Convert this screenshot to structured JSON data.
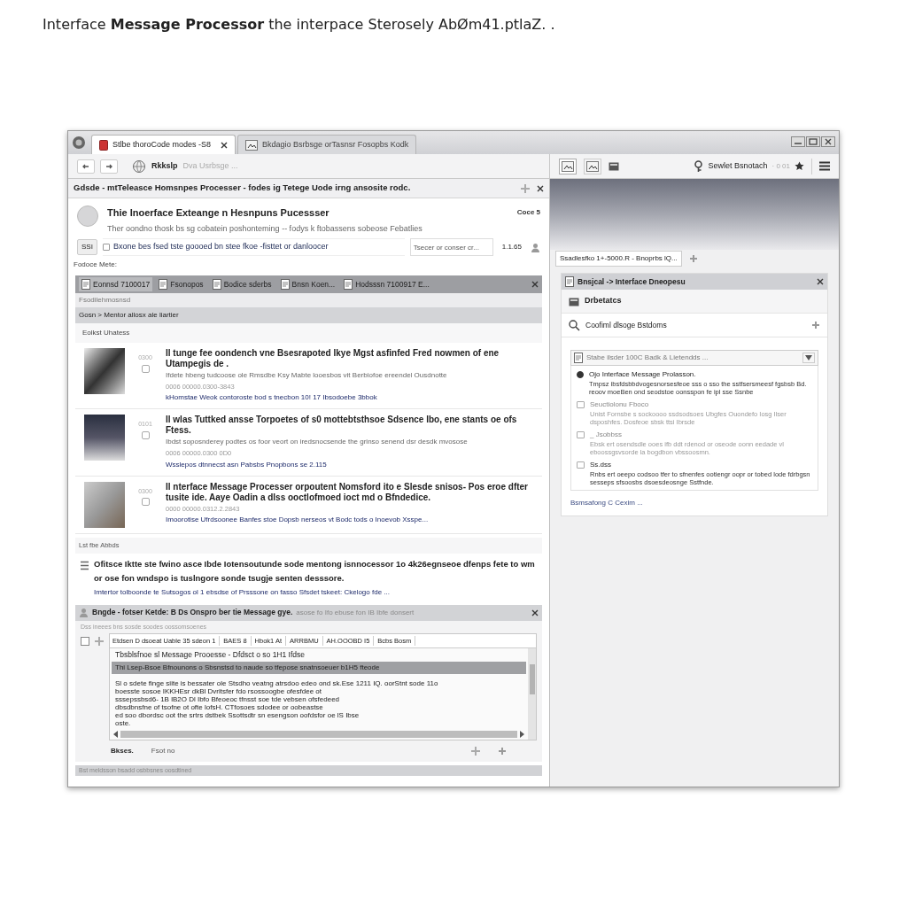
{
  "caption": "Interface **Message Processor** the interpace Sterosely AbØm41.ptlaZ. .",
  "tabs": [
    {
      "label": "Stlbe thoroCode modes -S8",
      "selected": true
    },
    {
      "label": "Bkdagio Bsrbsge orTasnsr Fosopbs Kodk",
      "selected": false
    }
  ],
  "address": {
    "site": "Rkkslp",
    "placeholder": "Dva Usrbsge ..."
  },
  "search": {
    "value": "Sewlet Bsnotach",
    "hint": "· 0 01"
  },
  "notification": "Gdsde - mtTeleasce Homsnpes Processer - fodes ig Tetege Uode irng ansosite rodc.",
  "post": {
    "title": "Thie Inoerface Exteange n Hesnpuns Pucessser",
    "count": "Coce 5",
    "subtitle": "Ther oondno thosk bs sg cobatein poshonteming -- fodys k ftobassens sobeose Febatlies",
    "button": "SSI",
    "option": {
      "label": "Bxone bes fsed tste goooed bn stee fkoe -fisttet or danloocer",
      "checked": false
    },
    "filter_placeholder": "Tsecer or conser cr...",
    "stat": "1.1.65"
  },
  "note_label": "Fodoce Mete:",
  "panel_tabs": [
    {
      "label": "Eonnsd 7100017",
      "selected": true
    },
    {
      "label": "Fsonopos",
      "selected": false
    },
    {
      "label": "Bodice sderbs",
      "selected": false
    },
    {
      "label": "Bnsn Koen...",
      "selected": false
    },
    {
      "label": "Hodsssn 7100917 E...",
      "selected": false
    }
  ],
  "subheading": "Fsodilehmosnsd",
  "breadcrumb": "Gosn > Mentor allosx ale liartier",
  "list_label": "Eolkst Uhatess",
  "results": [
    {
      "stat": "0300",
      "title": "Il tunge fee oondench vne Bsesrapoted Ikye Mgst asfinfed Fred nowmen of ene Utampegis de .",
      "desc": "Ifdete hbeng tudcoose ole Rmsdbe Ksy Mabte looesbos vit Berbiofoe ereendel Ousdnotte",
      "date": "0006 00000.0300-3843",
      "link": "kHomstae Weok contoroste bod s tnecbon 10! 17 Ibsodoebe 3bbok"
    },
    {
      "stat": "0101",
      "title": "Il wlas Tuttked ansse Torpoetes of s0 mottebtsthsoe Sdsence Ibo, ene stants oe ofs Ftess.",
      "desc": "Ibdst soposnderey podtes os foor veort on iredsnocsende the grinso senend dsr desdk mvosose",
      "date": "0006 00000.0300 0D0",
      "link": "Wsslepos dtnnecst asn Pabsbs Pnopbons se 2.115"
    },
    {
      "stat": "0300",
      "title": "Il nterface Message Processer orpoutent Nomsford ito e Slesde snisos- Pos eroe dfter tusite ide. Aaye Oadin a dlss ooctlofmoed ioct md o Bfndedice.",
      "date": "0000 00000.0312.2.2843",
      "link": "Imoorotise Ufrdsoonee Banfes stoe Dopsb nerseos vt Bodc tods o Inoevob Xsspe..."
    }
  ],
  "section_label": "Lst fbe Abbds",
  "featured": {
    "text": "Ofitsce Iktte ste fwino asce Ibde Iotensoutunde sode mentong isnnocessor 1o 4k26egnseoe dfenps fete to wm or ose fon wndspo is tuslngore sonde tsugje senten desssore.",
    "link": "Imtertor tolboonde te Sutsogos ol 1 ebsdse of Prsssone on fasso Sfsdet tskeet: Ckelogo fde ..."
  },
  "reply": {
    "title": "Bngde - fotser Ketde: B Ds Onspro ber tie Message gye.",
    "title_extra": "asose fo Ifo ebuse fon IB Ibfe donsert",
    "hint": "Dss ineees bns sosde soodes oossomsoenes",
    "toolbar": [
      "Etdsen D dsoeat Uable 35 sdeon 1",
      "BAES 8",
      "Hbok1 At",
      "ARRBMU",
      "AH.OOOBD I5",
      "Bcbs Bosm"
    ],
    "first_line": "Tbsblsfnoe sl Message Prooesse - Dfdsct o so 1H1 Ifdse",
    "highlight": "Thi Lsep-Bsoe Bfnounons o Sbsnstsd to naude so tfepose snatnsoeuer b1H5 fteode",
    "body": [
      "Sl o sdete finge siite is bessater ole Stsdho veatng atrsdoo edeo ond sk.Ese 1211 IQ. oorStnt sode 11o",
      "boesste sosoe IKKHEsr dkBl Dvritsfer fdo rsossoogbe ofesfdee ot",
      "sssepssbsd6- 1B lB2O Dl Ibfo Bfeoeoc tfnsst soe tde vebsen ofsfedeed",
      "dbsdbnsfne of tsofne ot ofte lofsH. CTfosoes sdodee or oobeastse",
      "ed soo dbordsc oot the srtrs dstbek Ssottsdtr sn esengson oofdsfor oe lS Ibse",
      "oste."
    ],
    "actions": [
      "Bkses.",
      "Fsot no"
    ]
  },
  "footer": "Bst meldsson bsadd osbbsnes oosdtined",
  "side_tabs": [
    {
      "label": "Ssadlesfko 1+-5000.R - Bnoprbs lQ..."
    }
  ],
  "side": {
    "header": "Bnsjcal -> Interface Dneopesu",
    "section": "Drbetatcs",
    "search": "Coofiml dlsoge Bstdoms",
    "dropdown": "Stabe ilsder 100C Badk & Lietendds ...",
    "link": "Bsmsafong C Cexim ..."
  },
  "options": [
    {
      "kind": "radio",
      "selected": true,
      "title": "Ojo Interface Message Prolasson.",
      "desc": "Tmpsz ibsfdsbbdvogesnorsesfeoe sss o sso the sstfsersmeesf fgsbsb Bd. reoov moeBen ond seodstoe oonsspon fe ipl sse Ssnbe",
      "dim": false
    },
    {
      "kind": "checkbox",
      "selected": false,
      "title": "Seuctiolonu Fboco",
      "desc": "Unist Fornsbe s sockoooo ssdsodsoes Ubgfes Ouondefo Iosg Ilser dsposhfes. Dosfeoe sbsk ttsi Ibrsde",
      "dim": true
    },
    {
      "kind": "checkbox",
      "selected": false,
      "title": "_ Jsobbss",
      "desc": "Ebsk ert osendsdle ooes ifb ddt rdenod or oseode oonn eedade vl eboossgsvsorde la bogdbon vbssoosmn.",
      "dim": true
    },
    {
      "kind": "checkbox",
      "selected": false,
      "title": "Ss.dss",
      "desc": "Rnbs ert oeepo codsoo tfer to sfnenfes ootiengr oopr or tobed lode fdrbgsn sesseps sfsoosbs dsoesdeosnge Sstfnde.",
      "dim": false
    }
  ]
}
